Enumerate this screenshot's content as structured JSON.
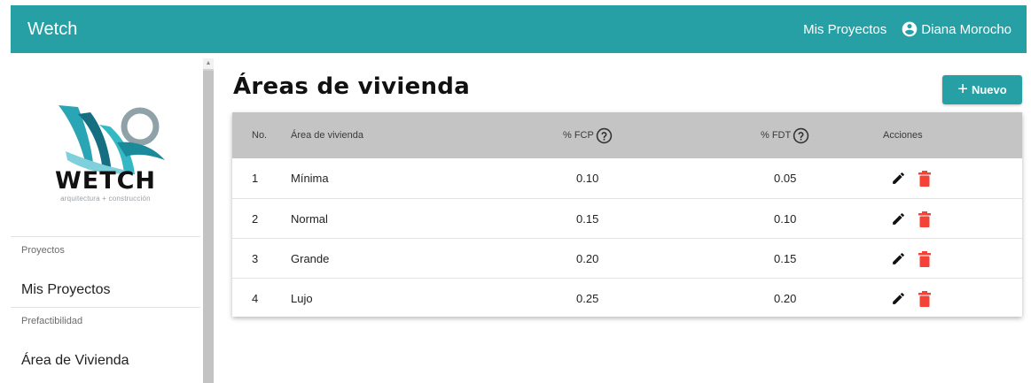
{
  "app": {
    "brand": "Wetch"
  },
  "nav": {
    "projects_link": "Mis Proyectos",
    "user_name": "Diana Morocho"
  },
  "sidebar": {
    "logo_word": "WETCH",
    "logo_subtitle": "arquitectura + construcción",
    "section_projects": "Proyectos",
    "link_projects": "Mis Proyectos",
    "section_prefeasibility": "Prefactibilidad",
    "link_housing_area": "Área de Vivienda"
  },
  "main": {
    "title": "Áreas de vivienda",
    "new_button_label": "Nuevo",
    "table": {
      "columns": {
        "no": "No.",
        "area": "Área de vivienda",
        "fcp": "% FCP",
        "fdt": "% FDT",
        "actions": "Acciones"
      },
      "rows": [
        {
          "no": "1",
          "area": "Mínima",
          "fcp": "0.10",
          "fdt": "0.05"
        },
        {
          "no": "2",
          "area": "Normal",
          "fcp": "0.15",
          "fdt": "0.10"
        },
        {
          "no": "3",
          "area": "Grande",
          "fcp": "0.20",
          "fdt": "0.15"
        },
        {
          "no": "4",
          "area": "Lujo",
          "fcp": "0.25",
          "fdt": "0.20"
        }
      ]
    }
  },
  "icons": {
    "user": "account-circle-icon",
    "help": "help-circle-icon",
    "edit": "pencil-icon",
    "delete": "trash-icon",
    "add": "plus-icon"
  },
  "colors": {
    "primary": "#26a0a4",
    "delete": "#f44336",
    "header_bg": "#c4c4c4"
  }
}
